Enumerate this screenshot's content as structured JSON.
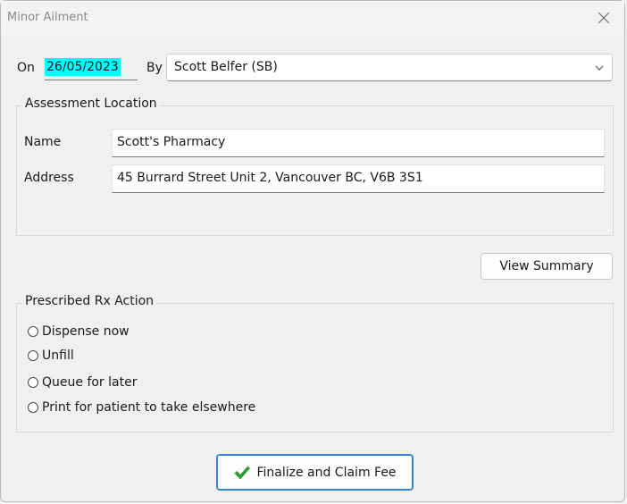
{
  "window": {
    "title": "Minor Ailment"
  },
  "header": {
    "on_label": "On",
    "date_value": "26/05/2023",
    "by_label": "By",
    "by_value": "Scott Belfer (SB)"
  },
  "assessment_location": {
    "legend": "Assessment Location",
    "name_label": "Name",
    "name_value": "Scott's Pharmacy",
    "address_label": "Address",
    "address_value": "45 Burrard Street Unit 2, Vancouver BC, V6B 3S1"
  },
  "view_summary_label": "View Summary",
  "prescribed_rx_action": {
    "legend": "Prescribed Rx Action",
    "options": [
      {
        "label": "Dispense now"
      },
      {
        "label": "Unfill"
      },
      {
        "label": "Queue for later"
      },
      {
        "label": "Print for patient to take elsewhere"
      }
    ]
  },
  "finalize_label": "Finalize and Claim Fee",
  "colors": {
    "date_highlight": "#00ffff",
    "check_green": "#2e9a2e",
    "primary_border": "#3c82c8"
  }
}
